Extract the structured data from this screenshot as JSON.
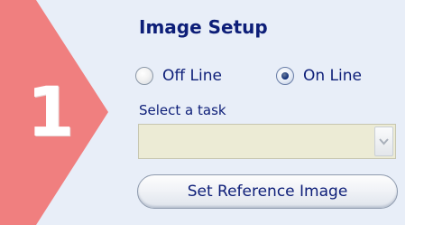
{
  "step": {
    "number": "1",
    "badge_color": "#f07f7f"
  },
  "section": {
    "title": "Image Setup"
  },
  "mode": {
    "options": [
      {
        "label": "Off Line",
        "selected": false
      },
      {
        "label": "On Line",
        "selected": true
      }
    ]
  },
  "task": {
    "label": "Select a task",
    "selected_value": ""
  },
  "actions": {
    "set_reference_label": "Set Reference Image"
  },
  "colors": {
    "panel_bg": "#e8eef8",
    "text": "#0d1e78",
    "select_bg": "#ecebd5"
  }
}
